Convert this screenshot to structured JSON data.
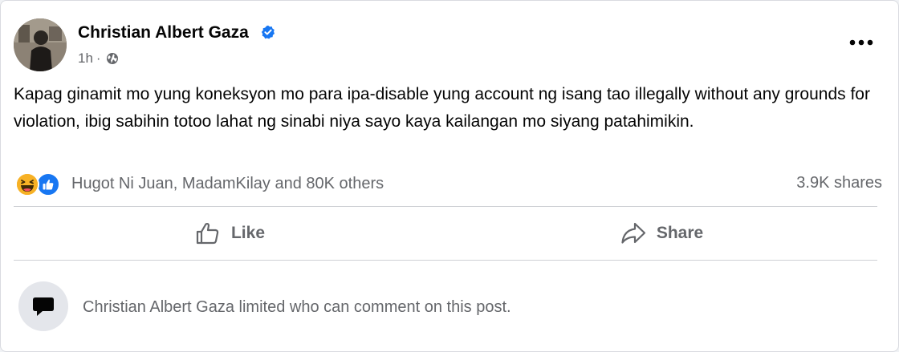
{
  "post": {
    "author": {
      "name": "Christian Albert Gaza",
      "verified": true,
      "avatar": "avatar-photo"
    },
    "timestamp": "1h",
    "separator": "·",
    "privacy_icon": "globe-icon",
    "more_icon": "more-options-icon",
    "text": "Kapag ginamit mo yung koneksyon mo para ipa-disable yung account ng isang tao illegally without any grounds for violation, ibig sabihin totoo lahat ng sinabi niya sayo kaya kailangan mo siyang patahimikin.",
    "reactions": {
      "icons": [
        "haha-icon",
        "like-icon"
      ],
      "summary": "Hugot Ni Juan, MadamKilay and 80K others",
      "shares": "3.9K shares"
    },
    "actions": [
      {
        "label": "Like",
        "icon": "thumbs-up-icon"
      },
      {
        "label": "Share",
        "icon": "share-arrow-icon"
      }
    ],
    "comment_notice": {
      "icon": "speech-bubble-icon",
      "text": "Christian Albert Gaza limited who can comment on this post."
    }
  },
  "colors": {
    "primary_text": "#050505",
    "secondary_text": "#65676b",
    "verified_blue": "#1877f2",
    "haha_yellow": "#f7b125",
    "divider": "#ced0d4"
  }
}
